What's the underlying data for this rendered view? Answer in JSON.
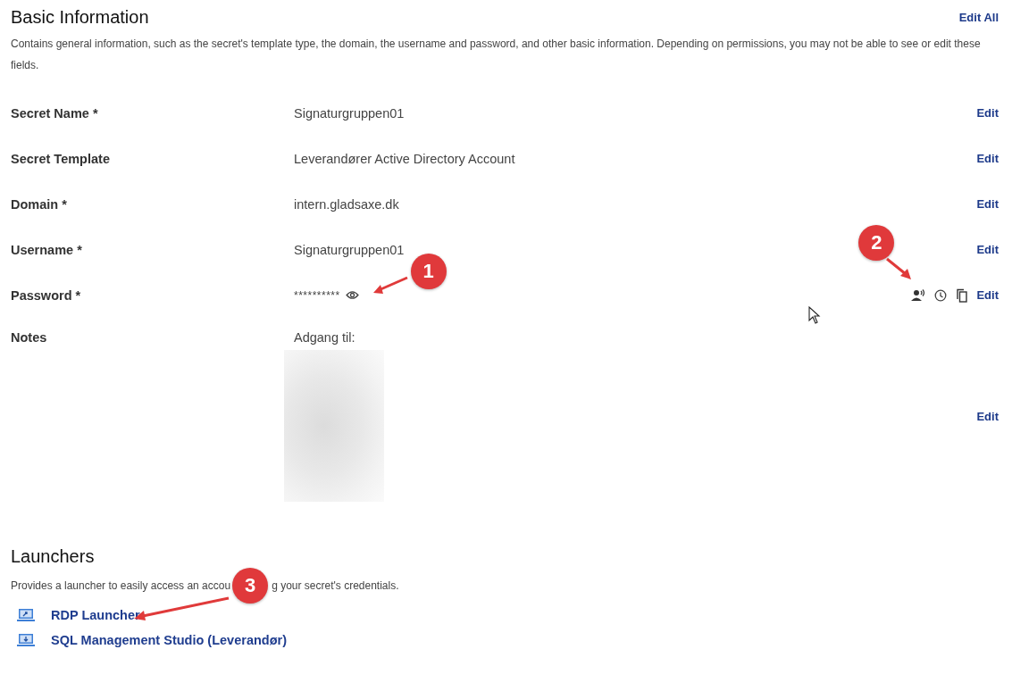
{
  "section": {
    "title": "Basic Information",
    "edit_all": "Edit All",
    "description": "Contains general information, such as the secret's template type, the domain, the username and password, and other basic information. Depending on permissions, you may not be able to see or edit these fields."
  },
  "fields": [
    {
      "label": "Secret Name *",
      "value": "Signaturgruppen01",
      "edit": "Edit",
      "kind": "text"
    },
    {
      "label": "Secret Template",
      "value": "Leverandører Active Directory Account",
      "edit": "Edit",
      "kind": "text"
    },
    {
      "label": "Domain *",
      "value": "intern.gladsaxe.dk",
      "edit": "Edit",
      "kind": "text"
    },
    {
      "label": "Username *",
      "value": "Signaturgruppen01",
      "edit": "Edit",
      "kind": "text"
    },
    {
      "label": "Password *",
      "value": "**********",
      "edit": "Edit",
      "kind": "password"
    },
    {
      "label": "Notes",
      "value": "Adgang til:",
      "edit": "Edit",
      "kind": "notes"
    }
  ],
  "launchers": {
    "title": "Launchers",
    "description_parts": [
      "Provides a launcher to easily access an accou",
      "g your secret's credentials."
    ],
    "items": [
      {
        "label": "RDP Launcher",
        "kind": "rdp"
      },
      {
        "label": "SQL Management Studio (Leverandør)",
        "kind": "sql"
      }
    ]
  },
  "callouts": [
    "1",
    "2",
    "3"
  ]
}
